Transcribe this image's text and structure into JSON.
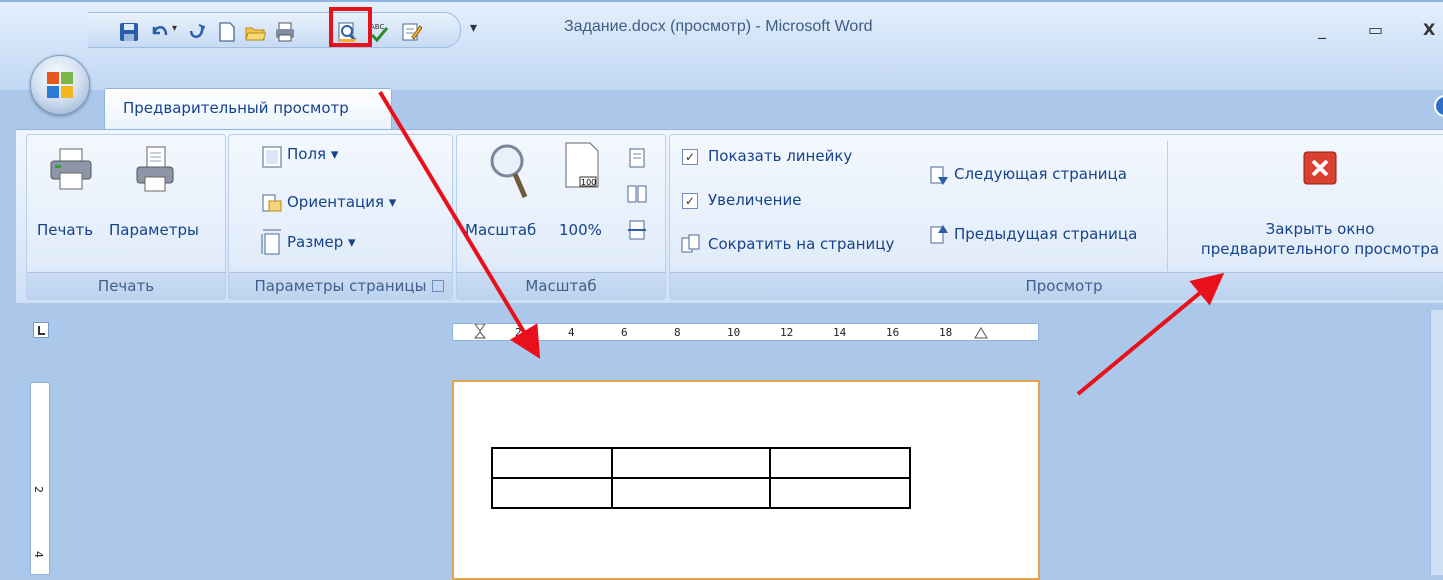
{
  "window": {
    "title": "Задание.docx (просмотр) - Microsoft Word",
    "minimize": "_",
    "maximize": "▭",
    "close": "X"
  },
  "tab": {
    "label": "Предварительный просмотр"
  },
  "groups": {
    "print": {
      "label": "Печать",
      "print_button": "Печать",
      "params_button": "Параметры"
    },
    "page_setup": {
      "label": "Параметры страницы",
      "margins": "Поля",
      "orientation": "Ориентация",
      "size": "Размер"
    },
    "zoom": {
      "label": "Масштаб",
      "zoom_button": "Масштаб",
      "zoom_100": "100%",
      "icon_100": "100"
    },
    "preview": {
      "label": "Просмотр",
      "show_ruler": "Показать линейку",
      "magnifier": "Увеличение",
      "shrink_one_page": "Сократить на страницу",
      "next_page": "Следующая страница",
      "prev_page": "Предыдущая страница",
      "close_line1": "Закрыть окно",
      "close_line2": "предварительного просмотра"
    }
  },
  "ruler": {
    "h_ticks": [
      "2",
      "4",
      "6",
      "8",
      "10",
      "12",
      "14",
      "16",
      "18"
    ],
    "v_ticks": [
      "2",
      "4"
    ]
  },
  "checkbox_state": {
    "show_ruler": true,
    "magnifier": true
  },
  "colors": {
    "arrow": "#e8101b",
    "page_border": "#e0a44c",
    "ribbon_text": "#15428b"
  }
}
